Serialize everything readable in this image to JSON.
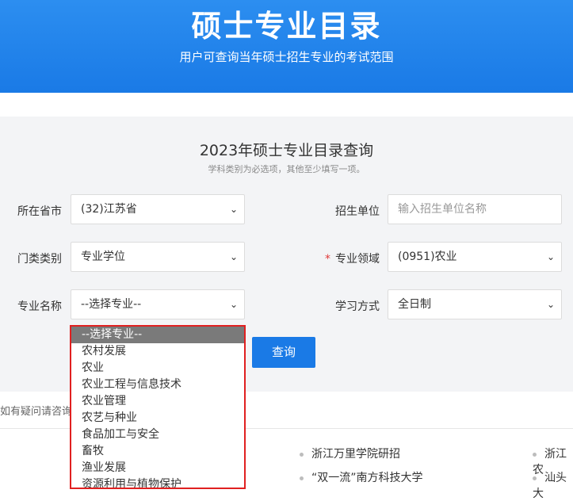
{
  "banner": {
    "title": "硕士专业目录",
    "subtitle": "用户可查询当年硕士招生专业的考试范围"
  },
  "search": {
    "title": "2023年硕士专业目录查询",
    "hint": "学科类别为必选项，其他至少填写一项。",
    "province_label": "所在省市",
    "province_value": "(32)江苏省",
    "unit_label": "招生单位",
    "unit_placeholder": "输入招生单位名称",
    "category_label": "门类类别",
    "category_value": "专业学位",
    "field_required_mark": "*",
    "field_label": "专业领域",
    "field_value": "(0951)农业",
    "major_label": "专业名称",
    "major_value": "--选择专业--",
    "mode_label": "学习方式",
    "mode_value": "全日制",
    "query_button": "查询"
  },
  "dropdown": {
    "options": [
      "--选择专业--",
      "农村发展",
      "农业",
      "农业工程与信息技术",
      "农业管理",
      "农艺与种业",
      "食品加工与安全",
      "畜牧",
      "渔业发展",
      "资源利用与植物保护"
    ],
    "selected_index": 0
  },
  "footer": {
    "help_text": "如有疑问请咨询",
    "links_col2": [
      "浙江万里学院研招",
      "“双一流”南方科技大学"
    ],
    "links_col3": [
      "浙江农",
      "汕头大"
    ]
  }
}
